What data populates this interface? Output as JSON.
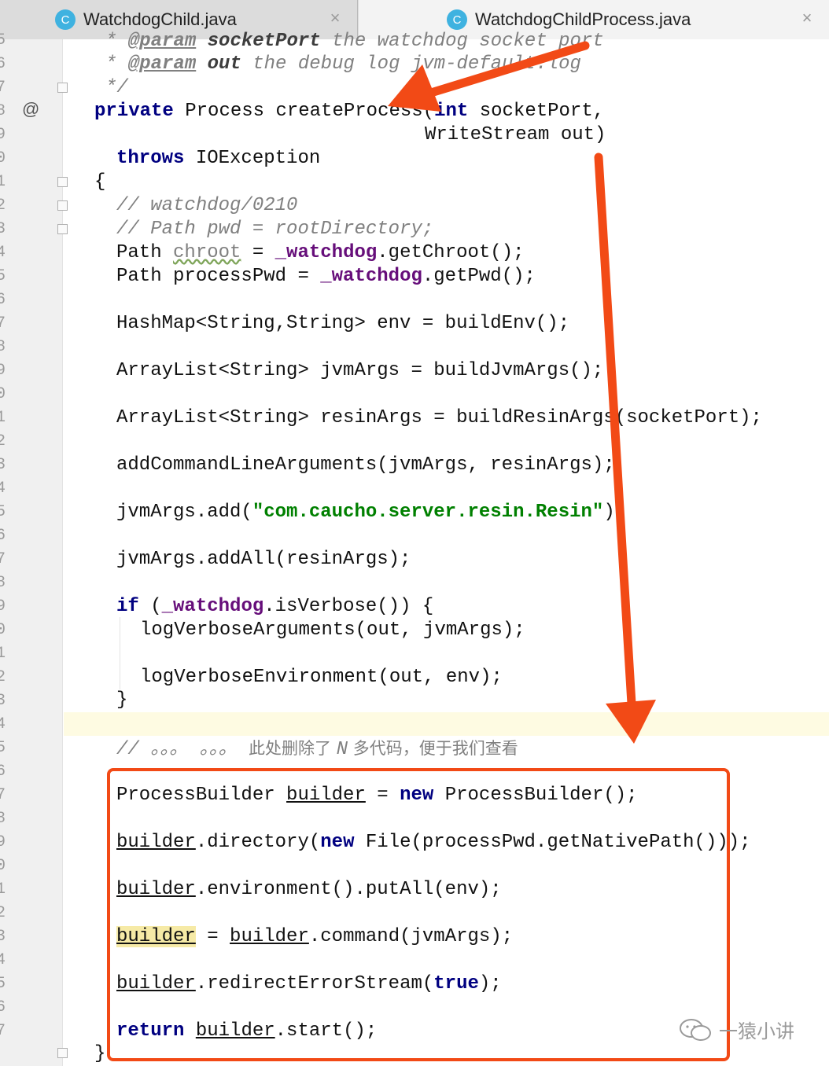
{
  "tabs": [
    {
      "label": "WatchdogChild.java",
      "icon": "class-icon",
      "icon_text": "C",
      "close": "×"
    },
    {
      "label": "WatchdogChildProcess.java",
      "icon": "class-icon",
      "icon_text": "C",
      "close": "×",
      "active": true
    }
  ],
  "gutter": {
    "line_digits": [
      "5",
      "6",
      "7",
      "8",
      "9",
      "0",
      "1",
      "2",
      "3",
      "4",
      "5",
      "6",
      "7",
      "8",
      "9",
      "0",
      "1",
      "2",
      "3",
      "4",
      "5",
      "6",
      "7",
      "8",
      "9",
      "0",
      "1",
      "2",
      "3",
      "4",
      "5",
      "6",
      "7",
      "8",
      "9",
      "0",
      "1",
      "2",
      "3",
      "4",
      "5",
      "6",
      "7"
    ],
    "override_marker": "@"
  },
  "code": {
    "l1_a": "* ",
    "l1_tag": "@param",
    "l1_name": " socketPort",
    "l1_rest": " the watchdog socket port",
    "l2_a": "* ",
    "l2_tag": "@param",
    "l2_name": " out",
    "l2_rest": " the debug log jvm-default.log",
    "l3": "*/",
    "l4_kw": "private",
    "l4_rest": " Process createProcess(",
    "l4_kw2": "int",
    "l4_rest2": " socketPort,",
    "l5": "WriteStream out)",
    "l6_kw": "throws",
    "l6_rest": " IOException",
    "l7": "{",
    "l8": "// watchdog/0210",
    "l9": "// Path pwd = rootDirectory;",
    "l10_a": "Path ",
    "l10_var": "chroot",
    "l10_b": " = ",
    "l10_fld": "_watchdog",
    "l10_c": ".getChroot();",
    "l11_a": "Path processPwd = ",
    "l11_fld": "_watchdog",
    "l11_c": ".getPwd();",
    "l12": "HashMap<String,String> env = buildEnv();",
    "l13": "ArrayList<String> jvmArgs = buildJvmArgs();",
    "l14": "ArrayList<String> resinArgs = buildResinArgs(socketPort);",
    "l15": "addCommandLineArguments(jvmArgs, resinArgs);",
    "l16_a": "jvmArgs.add(",
    "l16_str": "\"com.caucho.server.resin.Resin\"",
    "l16_c": ");",
    "l17": "jvmArgs.addAll(resinArgs);",
    "l18_kw": "if",
    "l18_a": " (",
    "l18_fld": "_watchdog",
    "l18_c": ".isVerbose()) {",
    "l19": "logVerboseArguments(out, jvmArgs);",
    "l20": "logVerboseEnvironment(out, env);",
    "l21": "}",
    "l22_a": "// 。。。 。。。 ",
    "l22_note": "此处删除了 ",
    "l22_n": "N",
    "l22_note2": " 多代码，便于我们查看",
    "l23_a": "ProcessBuilder ",
    "l23_var": "builder",
    "l23_b": " = ",
    "l23_kw": "new",
    "l23_c": " ProcessBuilder();",
    "l24_var": "builder",
    "l24_a": ".directory(",
    "l24_kw": "new",
    "l24_b": " File(processPwd.getNativePath()));",
    "l25_var": "builder",
    "l25_a": ".environment().putAll(env);",
    "l26_var": "builder",
    "l26_a": " = ",
    "l26_var2": "builder",
    "l26_b": ".command(jvmArgs);",
    "l27_var": "builder",
    "l27_a": ".redirectErrorStream(",
    "l27_kw": "true",
    "l27_b": ");",
    "l28_kw": "return",
    "l28_a": " ",
    "l28_var": "builder",
    "l28_b": ".start();",
    "l29": "}"
  },
  "watermark": "一猿小讲",
  "colors": {
    "annotation": "#f24a16",
    "keyword": "#000080",
    "field": "#660e7a",
    "string": "#008000",
    "comment": "#808080",
    "caret_line": "#fefbe2"
  }
}
